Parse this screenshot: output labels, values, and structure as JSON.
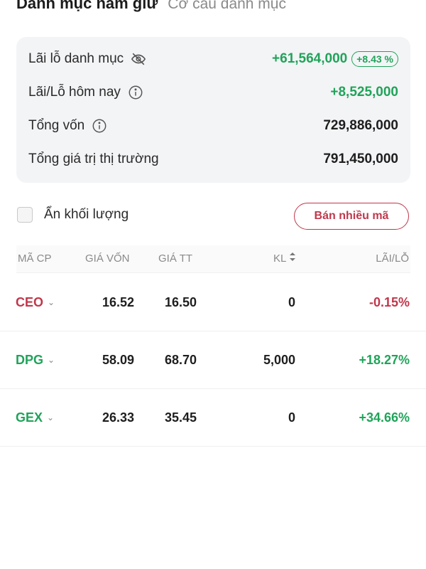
{
  "tabs": {
    "active": "Danh mục nắm giữ",
    "inactive": "Cơ cấu danh mục"
  },
  "summary": {
    "pnl_label": "Lãi lỗ danh mục",
    "pnl_value": "+61,564,000",
    "pnl_pct": "+8.43 %",
    "today_label": "Lãi/Lỗ hôm nay",
    "today_value": "+8,525,000",
    "capital_label": "Tổng vốn",
    "capital_value": "729,886,000",
    "market_label": "Tổng giá trị thị trường",
    "market_value": "791,450,000"
  },
  "controls": {
    "hide_volume_label": "Ẩn khối lượng",
    "sell_many_label": "Bán nhiều mã"
  },
  "table": {
    "headers": [
      "MÃ CP",
      "GIÁ VỐN",
      "GIÁ TT",
      "KL",
      "LÃI/LỖ"
    ],
    "rows": [
      {
        "ticker": "CEO",
        "cost": "16.52",
        "price": "16.50",
        "volume": "0",
        "pnl": "-0.15%"
      },
      {
        "ticker": "DPG",
        "cost": "58.09",
        "price": "68.70",
        "volume": "5,000",
        "pnl": "+18.27%"
      },
      {
        "ticker": "GEX",
        "cost": "26.33",
        "price": "35.45",
        "volume": "0",
        "pnl": "+34.66%"
      }
    ]
  },
  "colors": {
    "positive": "#20a35a",
    "negative": "#c0374b"
  },
  "icons": [
    "eye-off-icon",
    "info-icon",
    "sort-icon",
    "chevron-down-icon"
  ]
}
